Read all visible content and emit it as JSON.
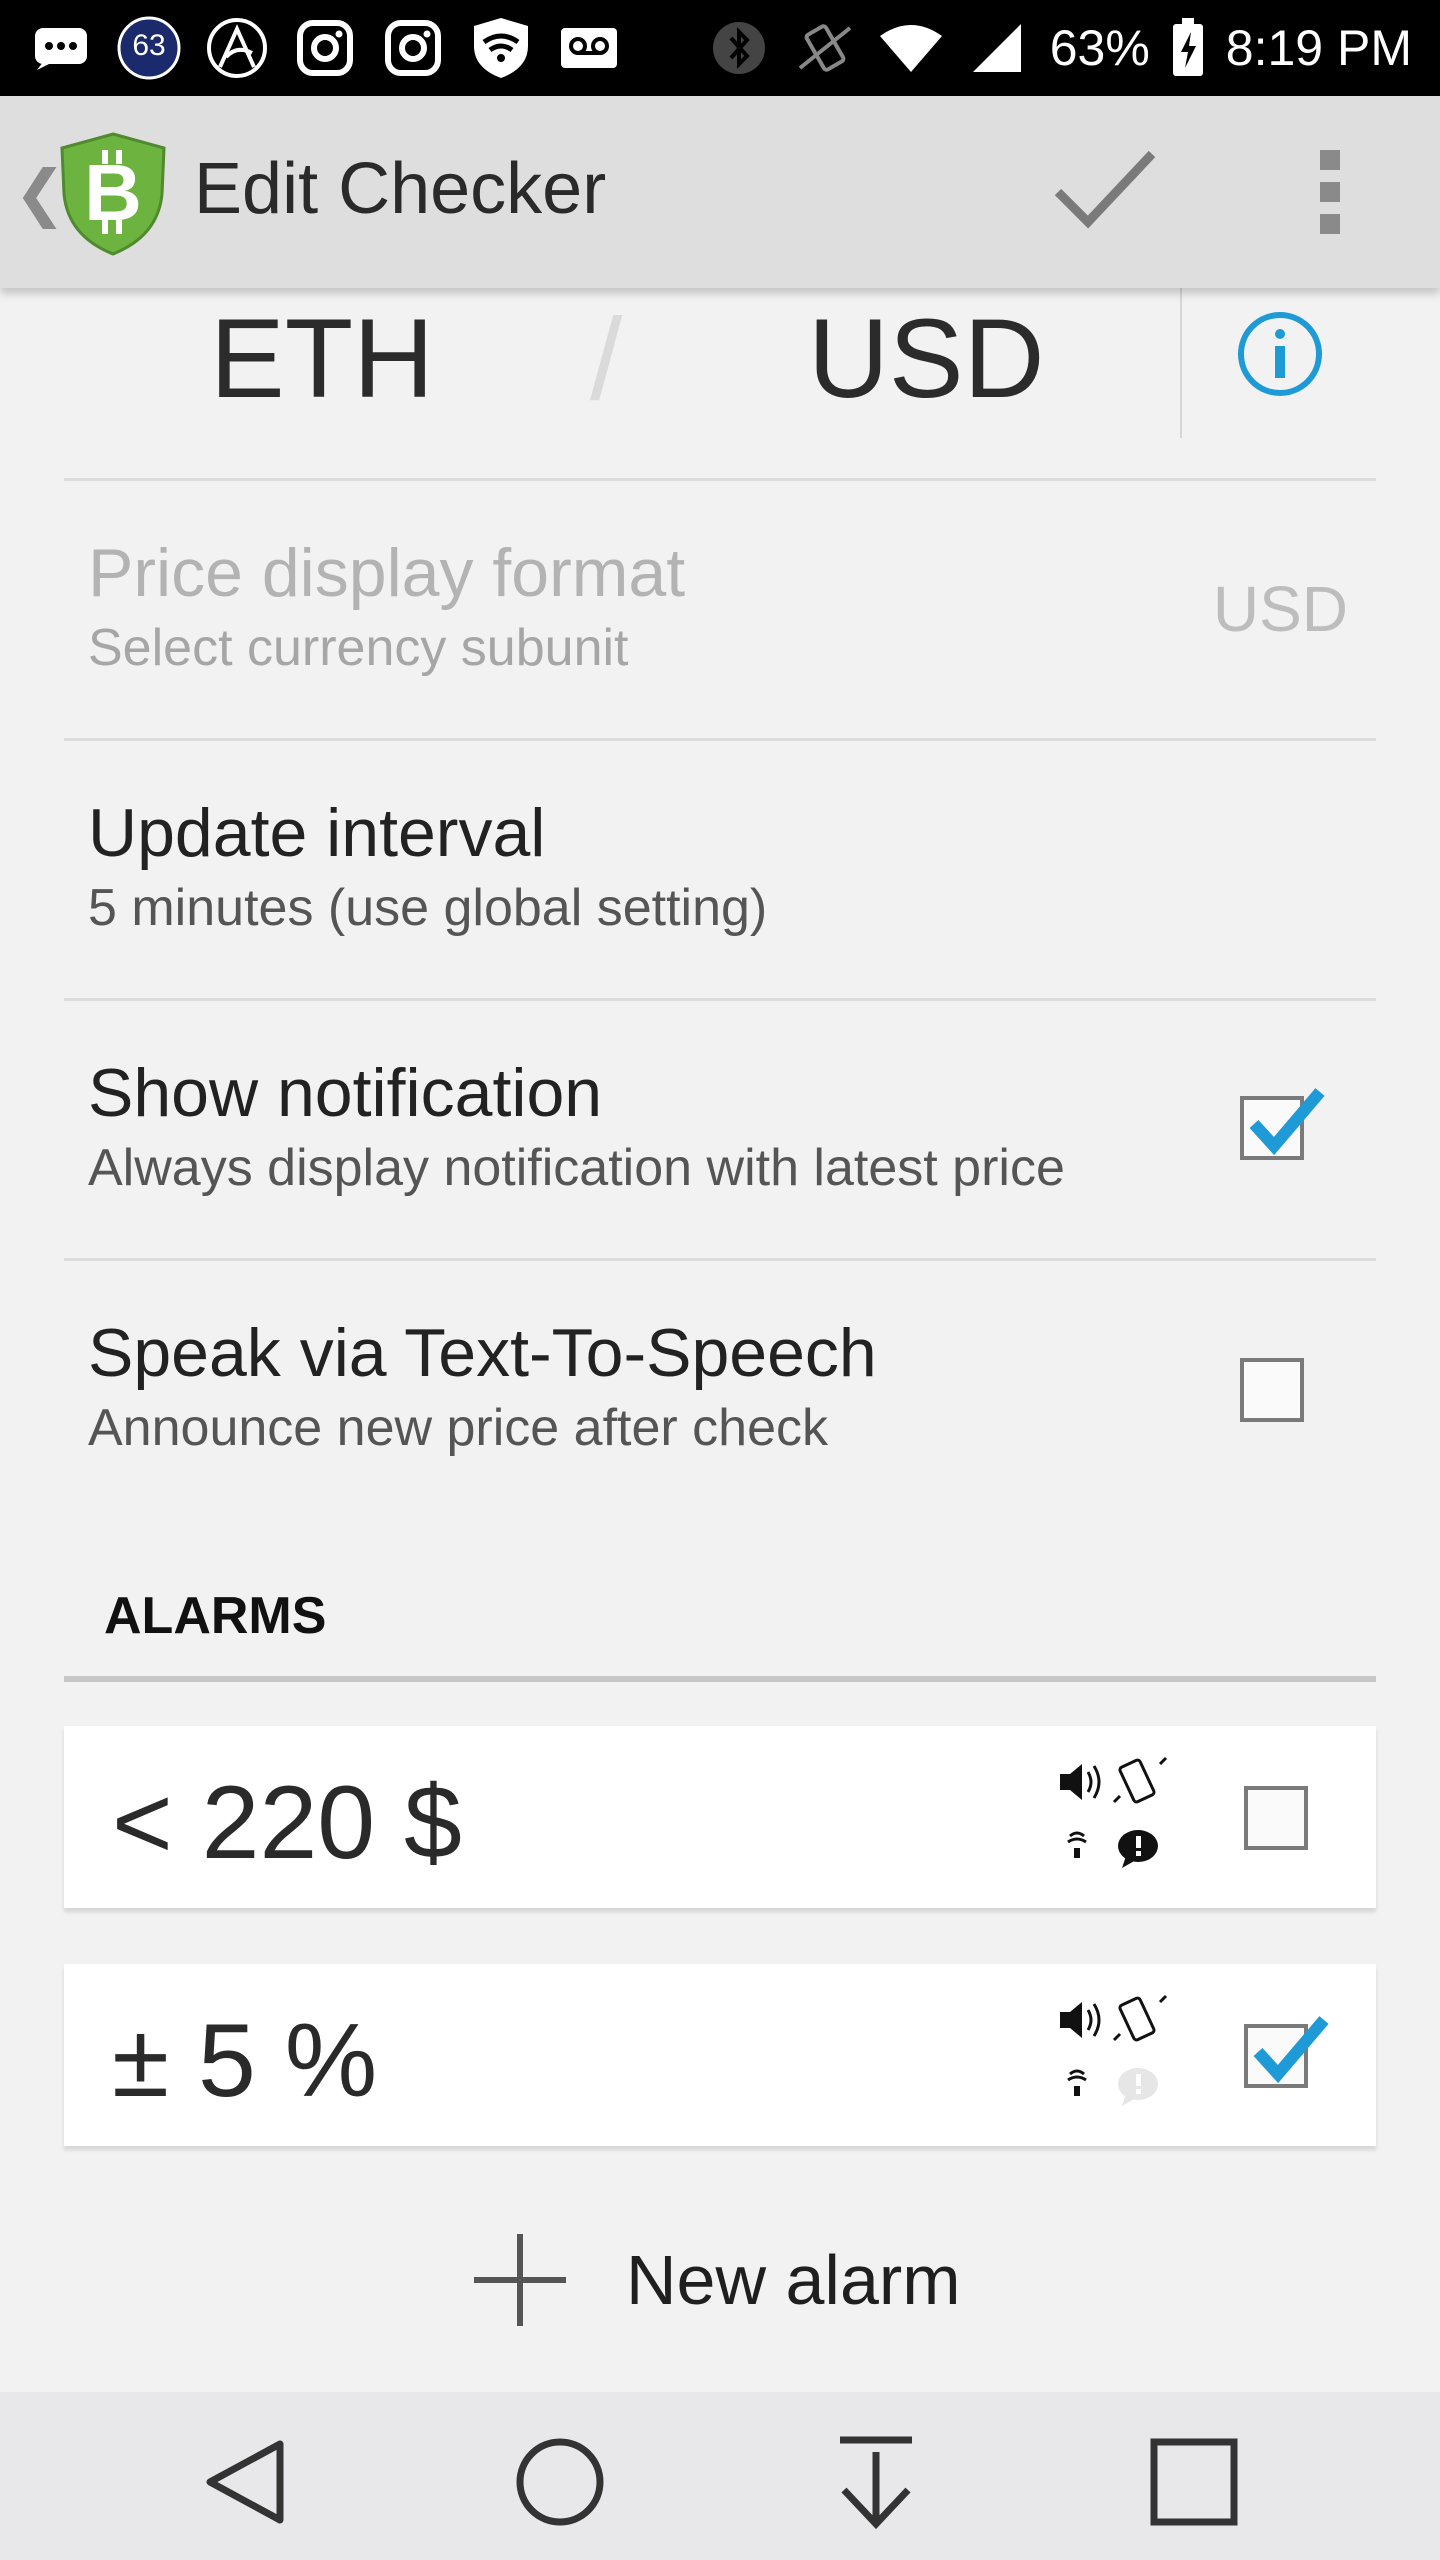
{
  "status_bar": {
    "notification_count": "63",
    "battery": "63%",
    "time": "8:19 PM",
    "icons": [
      "message-icon",
      "badge-63-icon",
      "arc-app-icon",
      "instagram-icon",
      "instagram-icon",
      "lookout-shield-icon",
      "voicemail-icon",
      "bluetooth-icon",
      "vibrate-icon",
      "wifi-icon",
      "cell-signal-icon",
      "battery-charging-icon"
    ]
  },
  "action_bar": {
    "title": "Edit Checker",
    "icons": [
      "back-chevron-icon",
      "bitcoin-shield-logo",
      "checkmark-icon",
      "overflow-menu-icon"
    ]
  },
  "pair": {
    "base": "ETH",
    "separator": "/",
    "quote": "USD",
    "info_icon": "info-icon"
  },
  "settings": {
    "price_display": {
      "title": "Price display format",
      "subtitle": "Select currency subunit",
      "value": "USD",
      "enabled": false
    },
    "update_interval": {
      "title": "Update interval",
      "subtitle": "5 minutes (use global setting)"
    },
    "show_notification": {
      "title": "Show notification",
      "subtitle": "Always display notification with latest price",
      "checked": true
    },
    "tts": {
      "title": "Speak via Text-To-Speech",
      "subtitle": "Announce new price after check",
      "checked": false
    }
  },
  "alarms": {
    "header": "ALARMS",
    "items": [
      {
        "label": "< 220 $",
        "checked": false,
        "popup_active": true
      },
      {
        "label": "± 5 %",
        "checked": true,
        "popup_active": false
      }
    ],
    "new_alarm_label": "New alarm"
  },
  "colors": {
    "accent": "#1e9bd7",
    "logo_green": "#6db33f",
    "status_bar": "#000000",
    "action_bar": "#dedede",
    "background": "#f2f2f3"
  }
}
